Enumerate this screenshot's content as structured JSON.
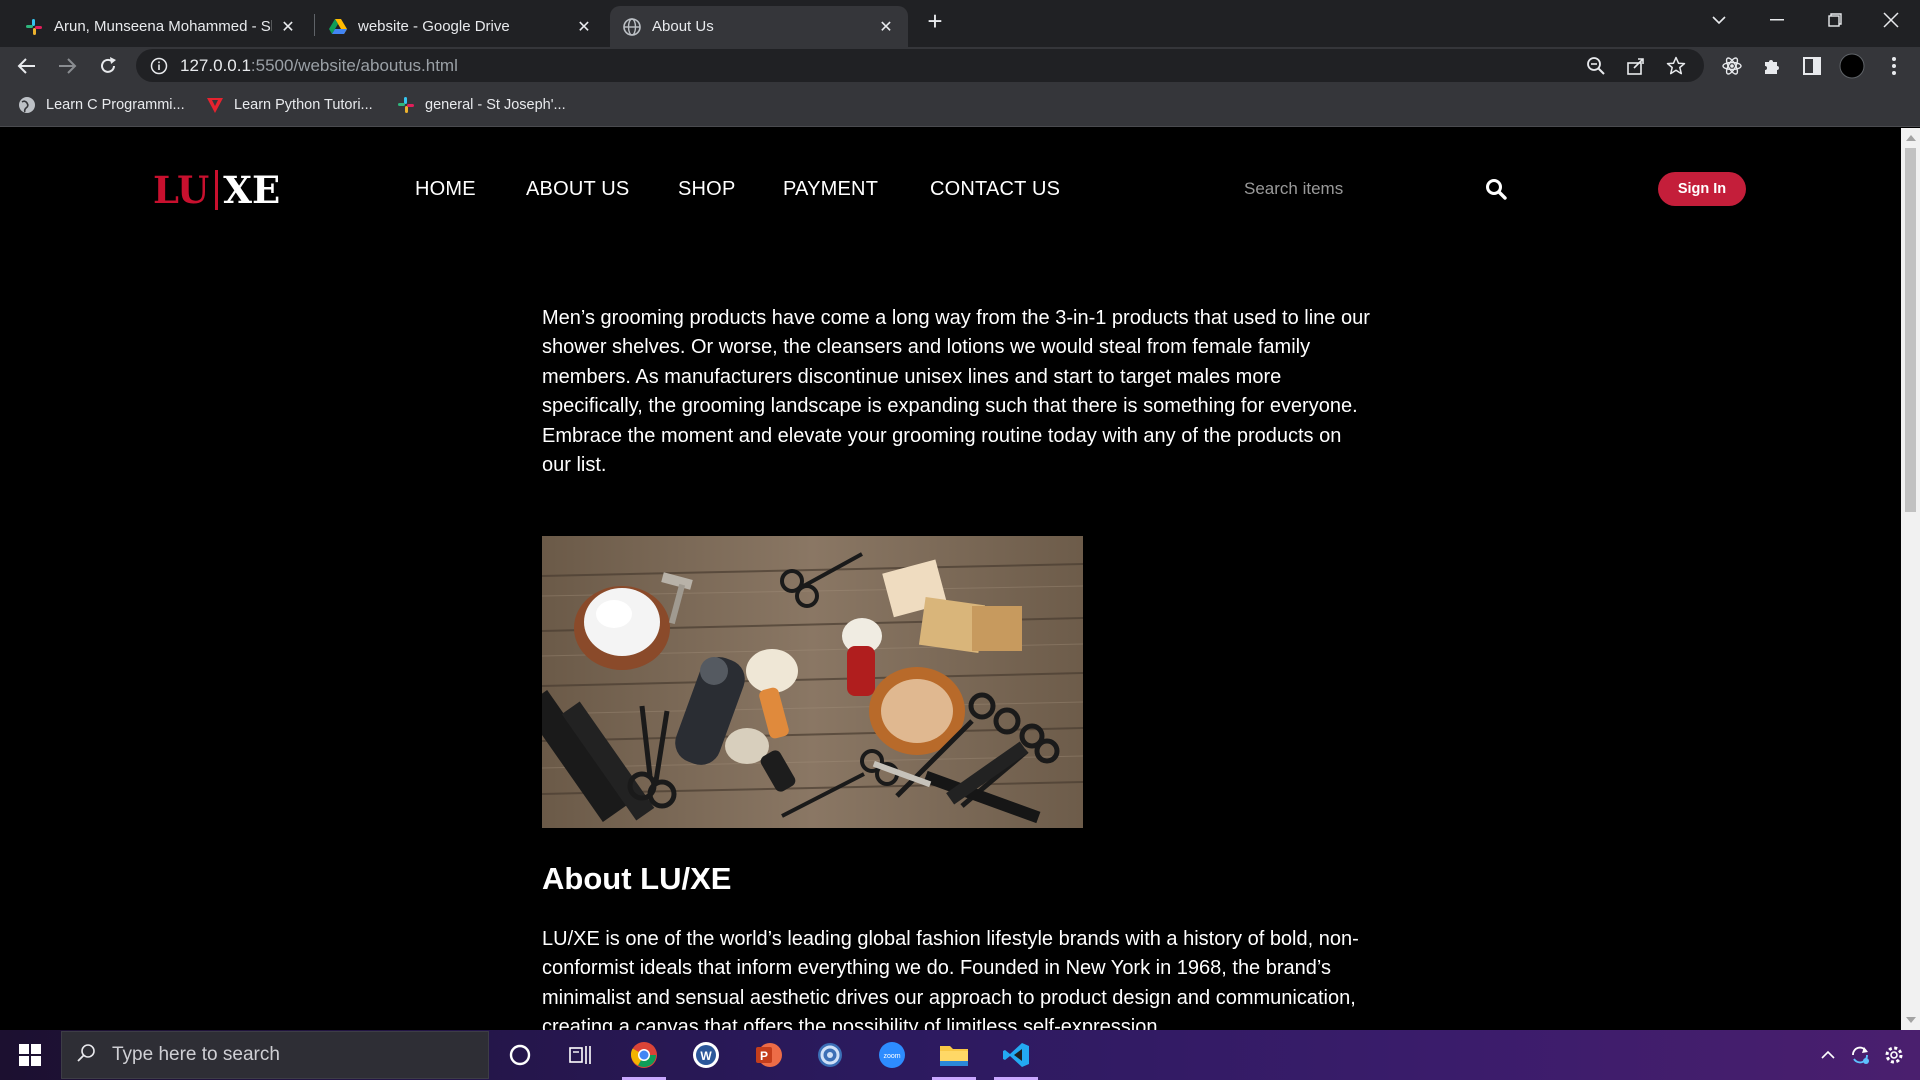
{
  "browser": {
    "tabs": [
      {
        "label": "Arun, Munseena Mohammed - Sl",
        "icon": "slack-icon"
      },
      {
        "label": "website - Google Drive",
        "icon": "google-drive-icon"
      },
      {
        "label": "About Us",
        "icon": "globe-icon",
        "active": true
      }
    ],
    "url_host": "127.0.0.1",
    "url_path": ":5500/website/aboutus.html",
    "bookmarks": [
      {
        "label": "Learn C Programmi...",
        "icon": "globe-icon"
      },
      {
        "label": "Learn Python Tutori...",
        "icon": "vlogo-icon"
      },
      {
        "label": "general - St Joseph'...",
        "icon": "slack-icon"
      }
    ]
  },
  "site": {
    "logo_left": "LU",
    "logo_right": "XE",
    "nav": [
      "HOME",
      "ABOUT US",
      "SHOP",
      "PAYMENT",
      "CONTACT US"
    ],
    "search_placeholder": "Search items",
    "signin_label": "Sign In",
    "intro": "Men’s grooming products have come a long way from the 3-in-1 products that used to line our shower shelves. Or worse, the cleansers and lotions we would steal from female family members. As manufacturers discontinue unisex lines and start to target males more specifically, the grooming landscape is expanding such that there is something for everyone. Embrace the moment and elevate your grooming routine today with any of the products on our list.",
    "about_title": "About LU/XE",
    "about_text": "LU/XE is one of the world’s leading global fashion lifestyle brands with a history of bold, non-conformist ideals that inform everything we do. Founded in New York in 1968, the brand’s minimalist and sensual aesthetic drives our approach to product design and communication, creating a canvas that offers the possibility of limitless self-expression."
  },
  "taskbar": {
    "search_placeholder": "Type here to search"
  },
  "colors": {
    "brand_red": "#c8102e",
    "signin_bg": "#c41e3a"
  }
}
